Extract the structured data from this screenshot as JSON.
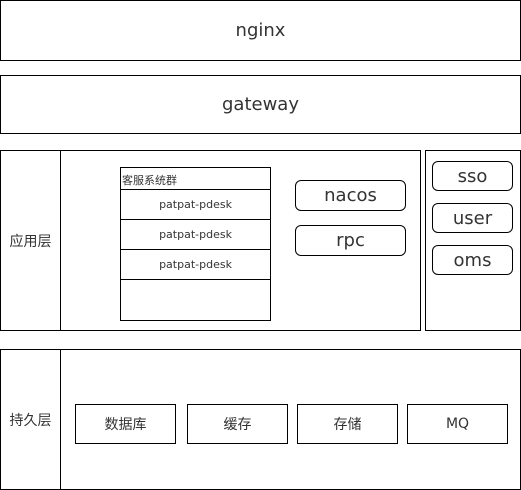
{
  "top": {
    "nginx": "nginx",
    "gateway": "gateway"
  },
  "app_layer": {
    "label": "应用层",
    "cluster": {
      "title": "客服系统群",
      "instances": [
        "patpat-pdesk",
        "patpat-pdesk",
        "patpat-pdesk"
      ]
    },
    "services": [
      "nacos",
      "rpc"
    ],
    "side": [
      "sso",
      "user",
      "oms"
    ]
  },
  "persist_layer": {
    "label": "持久层",
    "stores": [
      "数据库",
      "缓存",
      "存储",
      "MQ"
    ]
  }
}
